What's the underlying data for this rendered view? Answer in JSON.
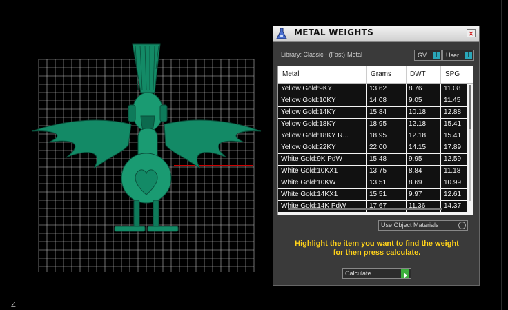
{
  "viewport": {
    "axis_label": "Z",
    "model": "rooster-pendant",
    "model_color": "#0e7a5a",
    "grid_color": "#bdbdbd",
    "axis_color": "#cc0000"
  },
  "panel": {
    "title": "METAL WEIGHTS",
    "close_glyph": "×",
    "library_label": "Library: Classic - (Fast)-Metal",
    "toggles": [
      {
        "label": "GV",
        "switch": "I"
      },
      {
        "label": "User",
        "switch": "I"
      }
    ],
    "table": {
      "columns": [
        "Metal",
        "Grams",
        "DWT",
        "SPG"
      ],
      "rows": [
        [
          "Yellow Gold:9KY",
          "13.62",
          "8.76",
          "11.08"
        ],
        [
          "Yellow Gold:10KY",
          "14.08",
          "9.05",
          "11.45"
        ],
        [
          "Yellow Gold:14KY",
          "15.84",
          "10.18",
          "12.88"
        ],
        [
          "Yellow Gold:18KY",
          "18.95",
          "12.18",
          "15.41"
        ],
        [
          "Yellow Gold:18KY R...",
          "18.95",
          "12.18",
          "15.41"
        ],
        [
          "Yellow Gold:22KY",
          "22.00",
          "14.15",
          "17.89"
        ],
        [
          "White Gold:9K PdW",
          "15.48",
          "9.95",
          "12.59"
        ],
        [
          "White Gold:10KX1",
          "13.75",
          "8.84",
          "11.18"
        ],
        [
          "White Gold:10KW",
          "13.51",
          "8.69",
          "10.99"
        ],
        [
          "White Gold:14KX1",
          "15.51",
          "9.97",
          "12.61"
        ],
        [
          "White Gold:14K PdW",
          "17.67",
          "11.36",
          "14.37"
        ]
      ]
    },
    "materials_dropdown": "Use Object Materials",
    "instruction_line1": "Highlight the item you want to find the weight",
    "instruction_line2": "for then press calculate.",
    "calculate_label": "Calculate",
    "accent_color": "#2aa6b8",
    "instruction_color": "#ffd21a"
  }
}
